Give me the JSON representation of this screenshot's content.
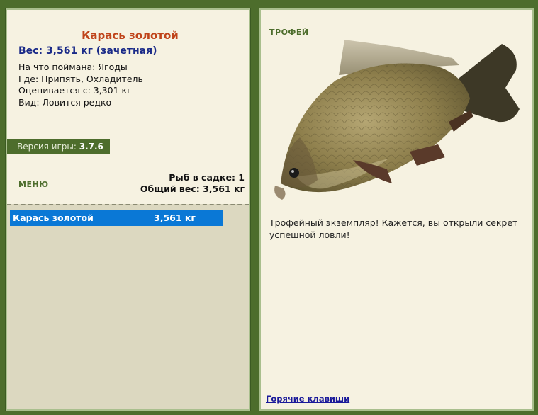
{
  "fish": {
    "title": "Карась золотой",
    "weight_line": "Вес: 3,561 кг (зачетная)",
    "caught_on": "На что поймана: Ягоды",
    "where": "Где: Припять, Охладитель",
    "valued_from": "Оценивается с: 3,301 кг",
    "kind": "Вид: Ловится редко"
  },
  "version": {
    "label": "Версия игры:",
    "value": "3.7.6"
  },
  "menu": {
    "label": "МЕНЮ"
  },
  "keepnet": {
    "fish_count": "Рыб в садке: 1",
    "total_weight": "Общий вес: 3,561 кг"
  },
  "fish_list": [
    {
      "name": "Карась золотой",
      "weight": "3,561 кг"
    }
  ],
  "trophy": {
    "label": "ТРОФЕЙ",
    "text": "Трофейный экземпляр! Кажется, вы открыли секрет успешной ловли!"
  },
  "hotkeys": {
    "label": "Горячие клавиши"
  },
  "colors": {
    "frame": "#4d6d2c",
    "panel": "#f6f2e1",
    "title": "#c0441a",
    "weight": "#1a2a88",
    "selection": "#0a78d6"
  }
}
